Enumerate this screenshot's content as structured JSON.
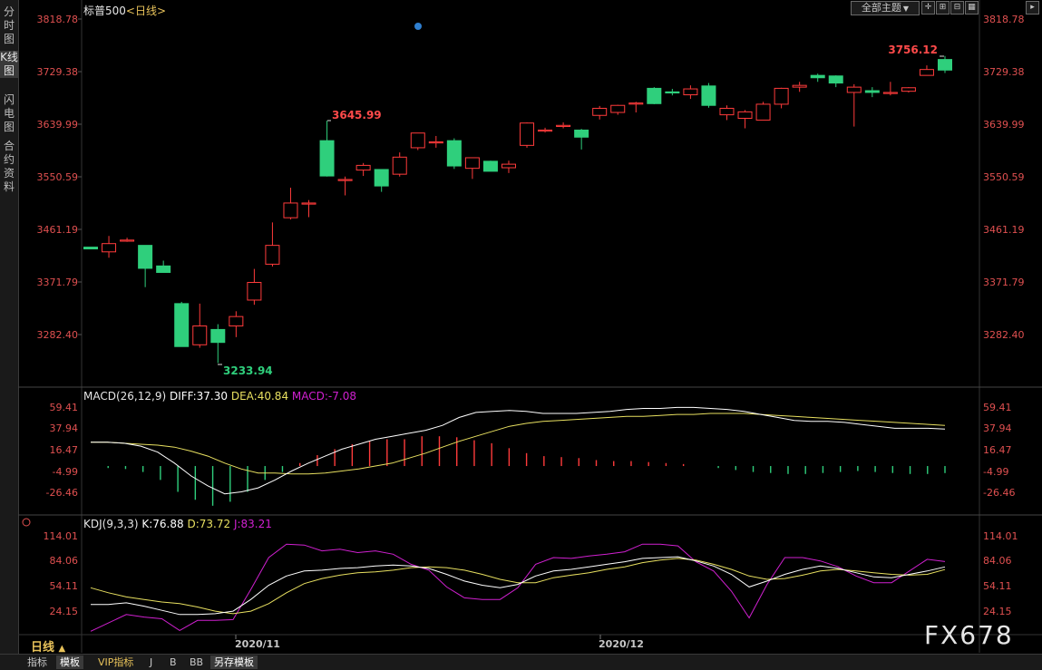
{
  "left_tabs": [
    "分时图",
    "K线图",
    "闪电图",
    "合约资料"
  ],
  "header": {
    "symbol": "标普500",
    "period_open": "<",
    "period": "日线",
    "period_close": ">",
    "theme_button": "全部主题",
    "theme_arrow": "▼"
  },
  "toolbar_icons": [
    "crosshair-icon",
    "zoom-in-icon",
    "zoom-out-icon",
    "grid-icon",
    "scroll-end-icon"
  ],
  "price_axis": {
    "ticks": [
      "3818.78",
      "3729.38",
      "3639.99",
      "3550.59",
      "3461.19",
      "3371.79",
      "3282.40"
    ],
    "min": 3230,
    "max": 3818.78
  },
  "macd_axis": {
    "ticks": [
      "59.41",
      "37.94",
      "16.47",
      "-4.99",
      "-26.46"
    ]
  },
  "kdj_axis": {
    "ticks": [
      "114.01",
      "84.06",
      "54.11",
      "24.15"
    ]
  },
  "date_labels": [
    "2020/11",
    "2020/12"
  ],
  "macd_legend": {
    "name": "MACD(26,12,9)",
    "diff": "DIFF:37.30",
    "dea": "DEA:40.84",
    "macd": "MACD:-7.08"
  },
  "kdj_legend": {
    "name": "KDJ(9,3,3)",
    "k": "K:76.88",
    "d": "D:73.72",
    "j": "J:83.21"
  },
  "annotations": {
    "high_1": "3645.99",
    "high_2": "3756.12",
    "low_1": "3233.94"
  },
  "period_label": "日线",
  "period_arrow": "▲",
  "bottom_tabs": [
    "指标",
    "模板",
    "VIP指标",
    "J",
    "B",
    "BB",
    "另存模板"
  ],
  "watermark": "FX678",
  "colors": {
    "up": "#ff3b3b",
    "down": "#2fcf7c",
    "diff": "#ffffff",
    "dea": "#e8e060",
    "macd_label": "#d020d0",
    "j": "#d020d0",
    "price_text": "#ff4a4a",
    "axis_text": "#e05050",
    "date_text": "#c8c8c8"
  },
  "chart_data": {
    "type": "candlestick",
    "candles": [
      {
        "o": 3431,
        "h": 3431,
        "l": 3428,
        "c": 3428
      },
      {
        "o": 3423,
        "h": 3450,
        "l": 3413,
        "c": 3437
      },
      {
        "o": 3443,
        "h": 3447,
        "l": 3440,
        "c": 3443
      },
      {
        "o": 3434,
        "h": 3434,
        "l": 3363,
        "c": 3395
      },
      {
        "o": 3399,
        "h": 3408,
        "l": 3388,
        "c": 3388
      },
      {
        "o": 3335,
        "h": 3338,
        "l": 3262,
        "c": 3262
      },
      {
        "o": 3265,
        "h": 3335,
        "l": 3260,
        "c": 3297
      },
      {
        "o": 3291,
        "h": 3300,
        "l": 3234,
        "c": 3269
      },
      {
        "o": 3297,
        "h": 3322,
        "l": 3278,
        "c": 3313
      },
      {
        "o": 3341,
        "h": 3394,
        "l": 3333,
        "c": 3371
      },
      {
        "o": 3402,
        "h": 3473,
        "l": 3398,
        "c": 3434
      },
      {
        "o": 3481,
        "h": 3532,
        "l": 3478,
        "c": 3506
      },
      {
        "o": 3506,
        "h": 3511,
        "l": 3482,
        "c": 3506
      },
      {
        "o": 3612,
        "h": 3646,
        "l": 3551,
        "c": 3552
      },
      {
        "o": 3546,
        "h": 3551,
        "l": 3519,
        "c": 3546
      },
      {
        "o": 3562,
        "h": 3574,
        "l": 3552,
        "c": 3570
      },
      {
        "o": 3563,
        "h": 3563,
        "l": 3525,
        "c": 3535
      },
      {
        "o": 3555,
        "h": 3592,
        "l": 3551,
        "c": 3584
      },
      {
        "o": 3600,
        "h": 3624,
        "l": 3596,
        "c": 3625
      },
      {
        "o": 3610,
        "h": 3620,
        "l": 3600,
        "c": 3610
      },
      {
        "o": 3612,
        "h": 3616,
        "l": 3564,
        "c": 3569
      },
      {
        "o": 3565,
        "h": 3580,
        "l": 3547,
        "c": 3583
      },
      {
        "o": 3577,
        "h": 3578,
        "l": 3562,
        "c": 3560
      },
      {
        "o": 3566,
        "h": 3578,
        "l": 3557,
        "c": 3572
      },
      {
        "o": 3604,
        "h": 3643,
        "l": 3600,
        "c": 3642
      },
      {
        "o": 3630,
        "h": 3634,
        "l": 3626,
        "c": 3630
      },
      {
        "o": 3638,
        "h": 3643,
        "l": 3633,
        "c": 3638
      },
      {
        "o": 3630,
        "h": 3632,
        "l": 3597,
        "c": 3618
      },
      {
        "o": 3655,
        "h": 3671,
        "l": 3648,
        "c": 3667
      },
      {
        "o": 3660,
        "h": 3673,
        "l": 3656,
        "c": 3672
      },
      {
        "o": 3676,
        "h": 3678,
        "l": 3660,
        "c": 3676
      },
      {
        "o": 3701,
        "h": 3703,
        "l": 3674,
        "c": 3675
      },
      {
        "o": 3695,
        "h": 3700,
        "l": 3689,
        "c": 3694
      },
      {
        "o": 3690,
        "h": 3706,
        "l": 3683,
        "c": 3700
      },
      {
        "o": 3705,
        "h": 3710,
        "l": 3668,
        "c": 3672
      },
      {
        "o": 3656,
        "h": 3672,
        "l": 3647,
        "c": 3667
      },
      {
        "o": 3650,
        "h": 3664,
        "l": 3633,
        "c": 3661
      },
      {
        "o": 3647,
        "h": 3678,
        "l": 3647,
        "c": 3674
      },
      {
        "o": 3674,
        "h": 3702,
        "l": 3667,
        "c": 3701
      },
      {
        "o": 3703,
        "h": 3712,
        "l": 3695,
        "c": 3706
      },
      {
        "o": 3723,
        "h": 3726,
        "l": 3712,
        "c": 3719
      },
      {
        "o": 3722,
        "h": 3723,
        "l": 3703,
        "c": 3710
      },
      {
        "o": 3694,
        "h": 3708,
        "l": 3636,
        "c": 3703
      },
      {
        "o": 3697,
        "h": 3703,
        "l": 3686,
        "c": 3694
      },
      {
        "o": 3694,
        "h": 3712,
        "l": 3689,
        "c": 3694
      },
      {
        "o": 3696,
        "h": 3703,
        "l": 3694,
        "c": 3702
      },
      {
        "o": 3723,
        "h": 3740,
        "l": 3723,
        "c": 3733
      },
      {
        "o": 3750,
        "h": 3756,
        "l": 3727,
        "c": 3732
      }
    ],
    "macd": {
      "diff": [
        24,
        24,
        23,
        20,
        14,
        3,
        -10,
        -20,
        -28,
        -26,
        -22,
        -14,
        -5,
        3,
        10,
        17,
        22,
        27,
        30,
        33,
        36,
        41,
        49,
        54,
        55,
        56,
        55,
        53,
        53,
        53,
        54,
        55,
        57,
        58,
        58,
        59,
        59,
        58,
        57,
        55,
        52,
        49,
        46,
        45,
        45,
        44,
        42,
        40,
        38,
        38,
        38,
        37.3
      ],
      "dea": [
        24,
        24,
        23,
        22,
        21,
        19,
        15,
        10,
        3,
        -3,
        -7,
        -7,
        -8,
        -8,
        -7,
        -5,
        -3,
        0,
        3,
        8,
        13,
        19,
        25,
        30,
        35,
        40,
        43,
        45,
        46,
        47,
        48,
        49,
        50,
        50,
        51,
        52,
        52,
        53,
        53,
        53,
        52,
        51,
        50,
        49,
        48,
        47,
        46,
        45,
        44,
        43,
        42,
        40.84
      ],
      "hist": [
        0,
        -2,
        -3,
        -6,
        -14,
        -26,
        -34,
        -40,
        -36,
        -26,
        -14,
        -6,
        3,
        11,
        17,
        22,
        25,
        27,
        27,
        30,
        30,
        29,
        26,
        23,
        18,
        13,
        10,
        9,
        8,
        6,
        5,
        5,
        4,
        3,
        2,
        0,
        -2,
        -4,
        -6,
        -7,
        -8,
        -8,
        -7,
        -6,
        -5,
        -6,
        -7,
        -8,
        -8,
        -7.08
      ]
    },
    "kdj": {
      "k": [
        32,
        32,
        34,
        30,
        25,
        20,
        20,
        21,
        24,
        38,
        55,
        66,
        72,
        73,
        75,
        76,
        78,
        79,
        78,
        75,
        68,
        60,
        55,
        52,
        56,
        66,
        72,
        74,
        77,
        80,
        83,
        87,
        88,
        89,
        84,
        78,
        68,
        53,
        60,
        68,
        74,
        78,
        75,
        70,
        65,
        64,
        68,
        72,
        76.88
      ],
      "d": [
        52,
        46,
        41,
        38,
        35,
        33,
        29,
        24,
        21,
        24,
        33,
        46,
        57,
        63,
        67,
        70,
        71,
        73,
        76,
        77,
        76,
        73,
        68,
        62,
        58,
        58,
        64,
        67,
        70,
        74,
        77,
        82,
        85,
        87,
        85,
        80,
        74,
        66,
        62,
        63,
        67,
        72,
        74,
        72,
        70,
        68,
        67,
        68,
        73.72
      ],
      "j": [
        0,
        10,
        20,
        17,
        15,
        1,
        13,
        13,
        14,
        50,
        88,
        104,
        103,
        96,
        98,
        94,
        96,
        92,
        80,
        73,
        53,
        40,
        38,
        38,
        52,
        80,
        88,
        87,
        90,
        92,
        95,
        104,
        104,
        102,
        83,
        72,
        48,
        16,
        56,
        88,
        88,
        84,
        77,
        66,
        58,
        58,
        72,
        86,
        83.21
      ]
    }
  }
}
